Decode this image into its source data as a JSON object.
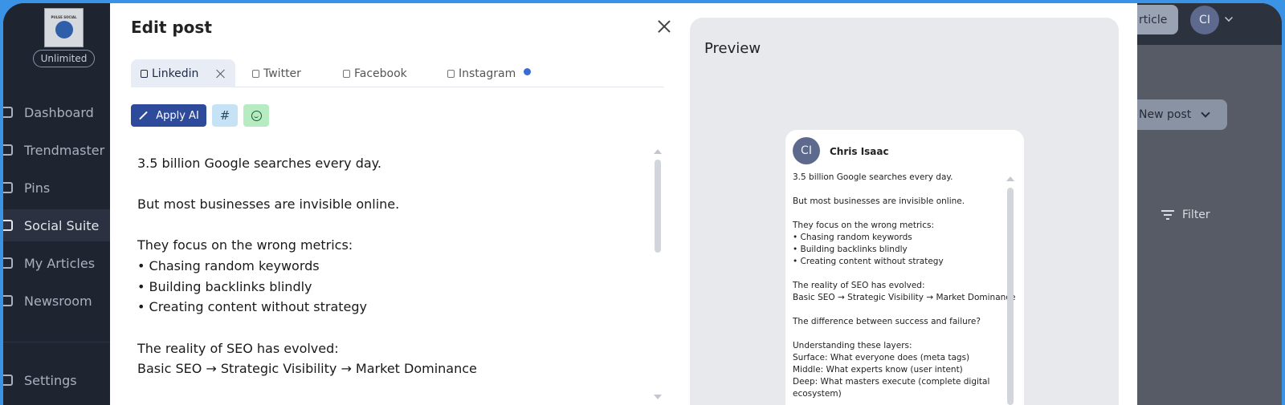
{
  "sidebar": {
    "logo_text": "PULSE SOCIAL",
    "plan": "Unlimited",
    "items": [
      {
        "label": "Dashboard"
      },
      {
        "label": "Trendmaster"
      },
      {
        "label": "Pins"
      },
      {
        "label": "Social Suite"
      },
      {
        "label": "My Articles"
      },
      {
        "label": "Newsroom"
      },
      {
        "label": "Settings"
      }
    ],
    "active": "Social Suite"
  },
  "topbar": {
    "article_button": "rticle",
    "avatar_initials": "CI"
  },
  "page": {
    "new_post_button": "New post",
    "filter_label": "Filter"
  },
  "modal": {
    "title": "Edit post",
    "tabs": [
      {
        "label": "Linkedin",
        "active": true
      },
      {
        "label": "Twitter"
      },
      {
        "label": "Facebook"
      },
      {
        "label": "Instagram"
      }
    ],
    "toolbar": {
      "apply_ai": "Apply AI",
      "hashtag": "#"
    },
    "editor_lines": [
      "3.5 billion Google searches every day.",
      "But most businesses are invisible online.",
      "They focus on the wrong metrics:",
      "• Chasing random keywords",
      "• Building backlinks blindly",
      "• Creating content without strategy",
      "The reality of SEO has evolved:",
      "Basic SEO → Strategic Visibility → Market Dominance"
    ]
  },
  "preview": {
    "title": "Preview",
    "author_initials": "CI",
    "author_name": "Chris Isaac",
    "lines": [
      "3.5 billion Google searches every day.",
      "But most businesses are invisible online.",
      "They focus on the wrong metrics:",
      "• Chasing random keywords",
      "• Building backlinks blindly",
      "• Creating content without strategy",
      "The reality of SEO has evolved:",
      "Basic SEO → Strategic Visibility → Market Dominance",
      "The difference between success and failure?",
      "Understanding these layers:",
      "Surface: What everyone does (meta tags)",
      "Middle: What experts know (user intent)",
      "Deep: What masters execute (complete digital",
      "ecosystem)"
    ]
  },
  "colors": {
    "accent": "#2e4a9a",
    "frame": "#3b93e6",
    "sidebar_bg": "#1f2431"
  }
}
